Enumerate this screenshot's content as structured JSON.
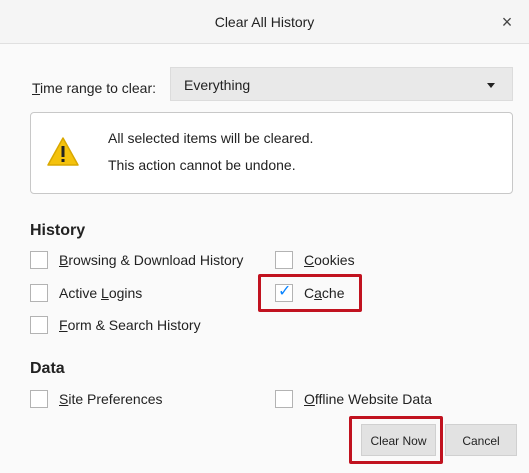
{
  "dialog": {
    "title": "Clear All History",
    "close_symbol": "×"
  },
  "time_range": {
    "label_prefix": "T",
    "label_rest": "ime range to clear:",
    "selected": "Everything"
  },
  "warning": {
    "line1": "All selected items will be cleared.",
    "line2": "This action cannot be undone."
  },
  "history": {
    "heading": "History",
    "items": [
      {
        "pre": "",
        "key": "B",
        "post": "rowsing & Download History",
        "checked": false
      },
      {
        "pre": "",
        "key": "C",
        "post": "ookies",
        "checked": false
      },
      {
        "pre": "Active ",
        "key": "L",
        "post": "ogins",
        "checked": false
      },
      {
        "pre": "C",
        "key": "a",
        "post": "che",
        "checked": true
      },
      {
        "pre": "",
        "key": "F",
        "post": "orm & Search History",
        "checked": false
      }
    ]
  },
  "data_section": {
    "heading": "Data",
    "items": [
      {
        "pre": "",
        "key": "S",
        "post": "ite Preferences",
        "checked": false
      },
      {
        "pre": "",
        "key": "O",
        "post": "ffline Website Data",
        "checked": false
      }
    ]
  },
  "buttons": {
    "clear_now": "Clear Now",
    "cancel": "Cancel"
  },
  "colors": {
    "highlight": "#c1121f",
    "check": "#0a84ff",
    "warning_icon": "#f4c20d"
  },
  "icons": [
    "close-icon",
    "dropdown-caret-icon",
    "warning-icon",
    "check-icon"
  ]
}
